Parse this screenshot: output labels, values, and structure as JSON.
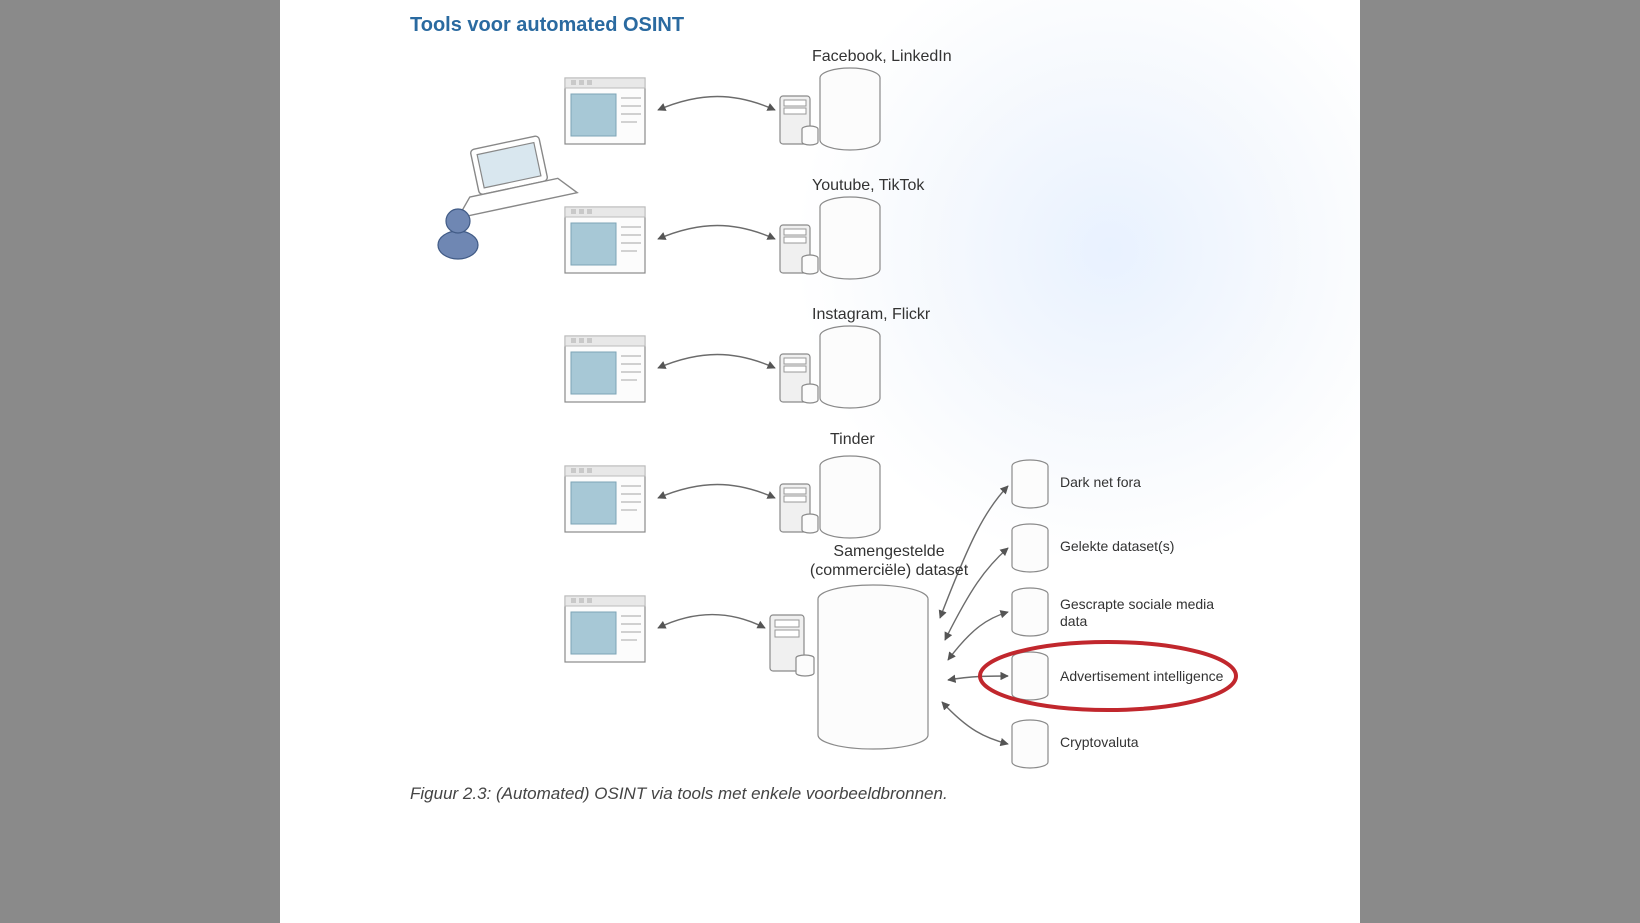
{
  "title": "Tools voor automated OSINT",
  "caption": "Figuur 2.3: (Automated) OSINT via tools met enkele voorbeeldbronnen.",
  "sources": [
    {
      "label": "Facebook, LinkedIn"
    },
    {
      "label": "Youtube, TikTok"
    },
    {
      "label": "Instagram, Flickr"
    },
    {
      "label": "Tinder"
    },
    {
      "label": "Samengestelde (commerciële) dataset"
    }
  ],
  "datasets": [
    {
      "label": "Dark net fora"
    },
    {
      "label": "Gelekte dataset(s)"
    },
    {
      "label": "Gescrapte sociale media data"
    },
    {
      "label": "Advertisement intelligence",
      "highlighted": true
    },
    {
      "label": "Cryptovaluta"
    }
  ]
}
